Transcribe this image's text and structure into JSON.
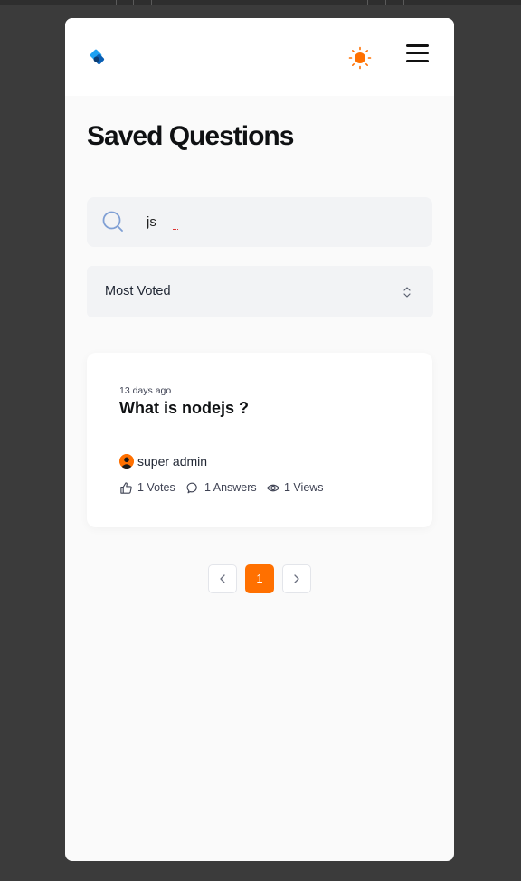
{
  "colors": {
    "accent": "#ff7000",
    "background": "#fafafa",
    "card": "#ffffff",
    "input_bg": "#f2f3f5",
    "text_dark": "#0f1113",
    "text_muted": "#3f4354",
    "logo_blue": "#1da1f2"
  },
  "header": {
    "logo_icon": "devflow-logo-icon",
    "theme_icon": "sun-icon",
    "menu_icon": "hamburger-menu-icon"
  },
  "page": {
    "title": "Saved Questions"
  },
  "search": {
    "icon": "search-icon",
    "value": "js",
    "placeholder": ""
  },
  "filter": {
    "selected": "Most Voted",
    "icon": "chevrons-up-down-icon"
  },
  "questions": [
    {
      "time_ago": "13 days ago",
      "title": "What is nodejs ?",
      "author": "super admin",
      "votes": "1 Votes",
      "answers": "1 Answers",
      "views": "1 Views"
    }
  ],
  "pagination": {
    "current_page": "1",
    "prev_icon": "chevron-left-icon",
    "next_icon": "chevron-right-icon"
  }
}
